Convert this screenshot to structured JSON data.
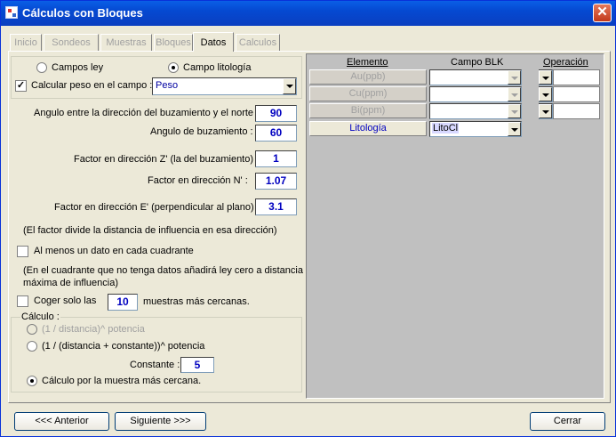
{
  "window": {
    "title": "Cálculos con Bloques",
    "close_glyph": "✕"
  },
  "tabs": [
    "Inicio",
    "Sondeos",
    "Muestras",
    "Bloques",
    "Datos",
    "Calculos"
  ],
  "left": {
    "radio_campos_ley": "Campos ley",
    "radio_campo_litologia": "Campo litología",
    "calc_peso_label": "Calcular peso en el campo :",
    "peso_field": "Peso",
    "angulo_norte_label": "Angulo entre la dirección del buzamiento y el norte :",
    "angulo_norte_value": "90",
    "angulo_buz_label": "Angulo de buzamiento :",
    "angulo_buz_value": "60",
    "factor_z_label": "Factor en dirección Z' (la del buzamiento) :",
    "factor_z_value": "1",
    "factor_n_label": "Factor en dirección N' :",
    "factor_n_value": "1.07",
    "factor_e_label": "Factor en dirección E' (perpendicular al plano) :",
    "factor_e_value": "3.1",
    "factor_note": "(El factor divide la distancia de influencia en esa dirección)",
    "al_menos_label": "Al menos un dato en cada cuadrante",
    "cuadrante_note_1": "(En el cuadrante que no tenga datos añadirá ley cero a distancia",
    "cuadrante_note_2": "máxima de influencia)",
    "coger_label": "Coger solo las",
    "coger_value": "10",
    "coger_suffix": "muestras más cercanas.",
    "calculo_title": "Cálculo :",
    "calc_opt1": "(1 / distancia)^ potencia",
    "calc_opt2": "(1 / (distancia + constante))^ potencia",
    "constante_label": "Constante :",
    "constante_value": "5",
    "calc_opt3": "Cálculo por la muestra más cercana."
  },
  "grid": {
    "head_elemento": "Elemento",
    "head_campo": "Campo BLK",
    "head_operacion": "Operación",
    "rows": [
      {
        "name": "Au(ppb)",
        "campo": ""
      },
      {
        "name": "Cu(ppm)",
        "campo": ""
      },
      {
        "name": "Bi(ppm)",
        "campo": ""
      },
      {
        "name": "Litología",
        "campo": "LitoCl"
      }
    ]
  },
  "footer": {
    "anterior": "<<<  Anterior",
    "siguiente": "Siguiente  >>>",
    "cerrar": "Cerrar"
  }
}
